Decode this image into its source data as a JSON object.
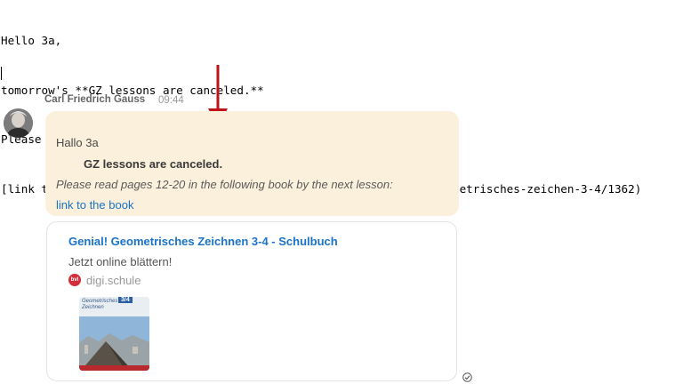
{
  "editor": {
    "lines": [
      "Hello 3a,",
      "tomorrow's **GZ lessons are canceled.**",
      "Please read pages 12-20 in the following book by the next lesson:*",
      "[link to the book](https://digi.schule/digibuecher/books/genial-geometrisches-zeichen-3-4/1362)"
    ]
  },
  "message": {
    "sender": "Carl Friedrich Gauss",
    "time": "09:44",
    "lines": [
      "Hallo 3a",
      "GZ lessons are canceled.",
      "Please read pages 12-20 in the following book by the next lesson:",
      "link to the book"
    ]
  },
  "preview": {
    "title": "Genial! Geometrisches Zeichnen 3-4 - Schulbuch",
    "description": "Jetzt online blättern!",
    "site": "digi.schule",
    "site_icon_text": "bvl",
    "thumbnail": {
      "title_line1": "Geometrisches",
      "title_line2": "Zeichnen",
      "badge": "3/4"
    }
  },
  "colors": {
    "bubble": "#fbf0dc",
    "link": "#1a73c8",
    "arrow": "#c0121b"
  },
  "icons": [
    "avatar",
    "site-icon",
    "read-receipt-check-icon",
    "annotation-arrow"
  ]
}
